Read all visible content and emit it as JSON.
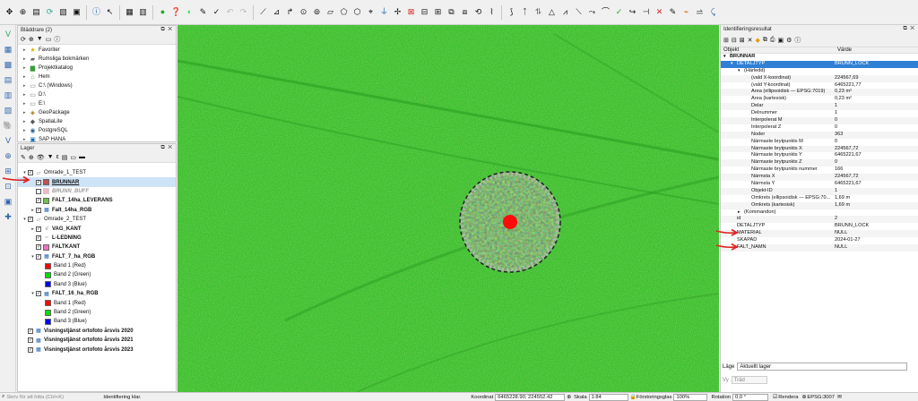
{
  "browser_panel": {
    "title": "Bläddrare (2)",
    "items": [
      {
        "label": "Favoriter",
        "icon": "star-icon"
      },
      {
        "label": "Rumsliga bokmärken",
        "icon": "bookmark-icon"
      },
      {
        "label": "Projektkatalog",
        "icon": "project-folder-icon"
      },
      {
        "label": "Hem",
        "icon": "home-folder-icon"
      },
      {
        "label": "C:\\ (Windows)",
        "icon": "drive-icon"
      },
      {
        "label": "D:\\",
        "icon": "drive-icon"
      },
      {
        "label": "E:\\",
        "icon": "drive-icon"
      },
      {
        "label": "GeoPackage",
        "icon": "geopackage-icon"
      },
      {
        "label": "SpatiaLite",
        "icon": "spatialite-icon"
      },
      {
        "label": "PostgreSQL",
        "icon": "postgresql-icon"
      },
      {
        "label": "SAP HANA",
        "icon": "sap-hana-icon"
      }
    ]
  },
  "layers_panel": {
    "title": "Lager",
    "rows": [
      {
        "label": "Omrade_1_TEST",
        "level": 0,
        "arrow": "▾",
        "checked": true,
        "type": "group",
        "bold": false,
        "selected": false
      },
      {
        "label": "BRUNNAR",
        "level": 1,
        "arrow": "",
        "checked": true,
        "type": "layer",
        "swatch": "#c0504d",
        "bold": true,
        "underline": true,
        "selected": true
      },
      {
        "label": "BRUNN_BUFF",
        "level": 1,
        "arrow": "",
        "checked": false,
        "type": "layer",
        "swatch": "#f4b6c2",
        "bold": true,
        "faded": true,
        "selected": false
      },
      {
        "label": "FALT_14ha_LEVERANS",
        "level": 1,
        "arrow": "",
        "checked": true,
        "type": "layer",
        "swatch": "#6dc24b",
        "bold": true,
        "selected": false
      },
      {
        "label": "Falt_14ha_RGB",
        "level": 1,
        "arrow": "▸",
        "checked": true,
        "type": "raster",
        "bold": true,
        "selected": false
      },
      {
        "label": "Omrade_2_TEST",
        "level": 0,
        "arrow": "▾",
        "checked": true,
        "type": "group",
        "bold": false,
        "selected": false
      },
      {
        "label": "VAG_KANT",
        "level": 1,
        "arrow": "▸",
        "checked": true,
        "type": "line",
        "bold": true,
        "selected": false
      },
      {
        "label": "L-LEDNING",
        "level": 1,
        "arrow": "",
        "checked": true,
        "type": "line2",
        "bold": true,
        "selected": false
      },
      {
        "label": "FALTKANT",
        "level": 1,
        "arrow": "",
        "checked": true,
        "type": "layer",
        "swatch": "#f06ec2",
        "bold": true,
        "selected": false
      },
      {
        "label": "FALT_7_ha_RGB",
        "level": 1,
        "arrow": "▾",
        "checked": true,
        "type": "raster",
        "bold": true,
        "selected": false
      },
      {
        "label": "Band 1 (Red)",
        "level": 2,
        "type": "band",
        "swatch": "#ff0000"
      },
      {
        "label": "Band 2 (Green)",
        "level": 2,
        "type": "band",
        "swatch": "#00dd00"
      },
      {
        "label": "Band 3 (Blue)",
        "level": 2,
        "type": "band",
        "swatch": "#0000ff"
      },
      {
        "label": "FALT_16_ha_RGB",
        "level": 1,
        "arrow": "▾",
        "checked": true,
        "type": "raster",
        "bold": true,
        "selected": false
      },
      {
        "label": "Band 1 (Red)",
        "level": 2,
        "type": "band",
        "swatch": "#ff0000"
      },
      {
        "label": "Band 2 (Green)",
        "level": 2,
        "type": "band",
        "swatch": "#00dd00"
      },
      {
        "label": "Band 3 (Blue)",
        "level": 2,
        "type": "band",
        "swatch": "#0000ff"
      },
      {
        "label": "Visningstjänst ortofoto årsvis 2020",
        "level": 0,
        "arrow": "",
        "checked": true,
        "type": "raster",
        "bold": true,
        "selected": false
      },
      {
        "label": "Visningstjänst ortofoto årsvis 2021",
        "level": 0,
        "arrow": "",
        "checked": true,
        "type": "raster",
        "bold": true,
        "selected": false
      },
      {
        "label": "Visningstjänst ortofoto årsvis 2023",
        "level": 0,
        "arrow": "",
        "checked": true,
        "type": "raster",
        "bold": true,
        "selected": false
      }
    ]
  },
  "identify_panel": {
    "title": "Identifieringsresultat",
    "col_object": "Objekt",
    "col_value": "Värde",
    "rows": [
      {
        "k": "BRUNNAR",
        "v": "",
        "indent": 0,
        "arrow": "▾",
        "bold": true
      },
      {
        "k": "DETALJTYP",
        "v": "BRUNN_LOCK",
        "indent": 1,
        "arrow": "▾",
        "selected": true
      },
      {
        "k": "(Härledd)",
        "v": "",
        "indent": 2,
        "arrow": "▾"
      },
      {
        "k": "(vald X-koordinat)",
        "v": "224567,69",
        "indent": 3
      },
      {
        "k": "(vald Y-koordinat)",
        "v": "6465221,77",
        "indent": 3
      },
      {
        "k": "Area (ellipsoidisk — EPSG:7019)",
        "v": "0,23 m²",
        "indent": 3
      },
      {
        "k": "Area (kartesisk)",
        "v": "0,23 m²",
        "indent": 3
      },
      {
        "k": "Delar",
        "v": "1",
        "indent": 3
      },
      {
        "k": "Delnummer",
        "v": "1",
        "indent": 3
      },
      {
        "k": "Interpolerat M",
        "v": "0",
        "indent": 3
      },
      {
        "k": "Interpolerat Z",
        "v": "0",
        "indent": 3
      },
      {
        "k": "Noder",
        "v": "363",
        "indent": 3
      },
      {
        "k": "Närmaste brytpunkts M",
        "v": "0",
        "indent": 3
      },
      {
        "k": "Närmaste brytpunkts X",
        "v": "224567,72",
        "indent": 3
      },
      {
        "k": "Närmaste brytpunkts Y",
        "v": "6465221,67",
        "indent": 3
      },
      {
        "k": "Närmaste brytpunkts Z",
        "v": "0",
        "indent": 3
      },
      {
        "k": "Närmaste brytpunkts nummer",
        "v": "166",
        "indent": 3
      },
      {
        "k": "Närmsta X",
        "v": "224567,72",
        "indent": 3
      },
      {
        "k": "Närmsta Y",
        "v": "6465221,67",
        "indent": 3
      },
      {
        "k": "Objekt-ID",
        "v": "1",
        "indent": 3
      },
      {
        "k": "Omkrets (ellipsoidisk — EPSG:70...",
        "v": "1,69 m",
        "indent": 3
      },
      {
        "k": "Omkrets (kartesisk)",
        "v": "1,69 m",
        "indent": 3
      },
      {
        "k": "(Kommandon)",
        "v": "",
        "indent": 2,
        "arrow": "▸"
      },
      {
        "k": "id",
        "v": "2",
        "indent": 1
      },
      {
        "k": "DETALJTYP",
        "v": "BRUNN_LOCK",
        "indent": 1
      },
      {
        "k": "MATERIAL",
        "v": "NULL",
        "indent": 1
      },
      {
        "k": "SKAPAD",
        "v": "2024-01-27",
        "indent": 1
      },
      {
        "k": "FALT_NAMN",
        "v": "NULL",
        "indent": 1
      }
    ],
    "mode_label": "Läge",
    "mode_value": "Aktuellt lager",
    "view_label": "Vy",
    "view_value": "Träd"
  },
  "statusbar": {
    "search_placeholder": "Skriv för att hitta (Ctrl+K)",
    "message": "Identifiering klar.",
    "coord_label": "Koordinat",
    "coord_value": "6465228.90, 224552.42",
    "scale_label": "Skala",
    "scale_value": "1:84",
    "magnifier_label": "Förstoringsglas",
    "magnifier_value": "100%",
    "rotation_label": "Rotation",
    "rotation_value": "0,0 °",
    "render_label": "Rendera",
    "crs_label": "EPSG:3007"
  },
  "colors": {
    "map_green": "#3bbf2a",
    "selection_blue": "#2f7fd5",
    "annotation_red": "#e0201c"
  }
}
